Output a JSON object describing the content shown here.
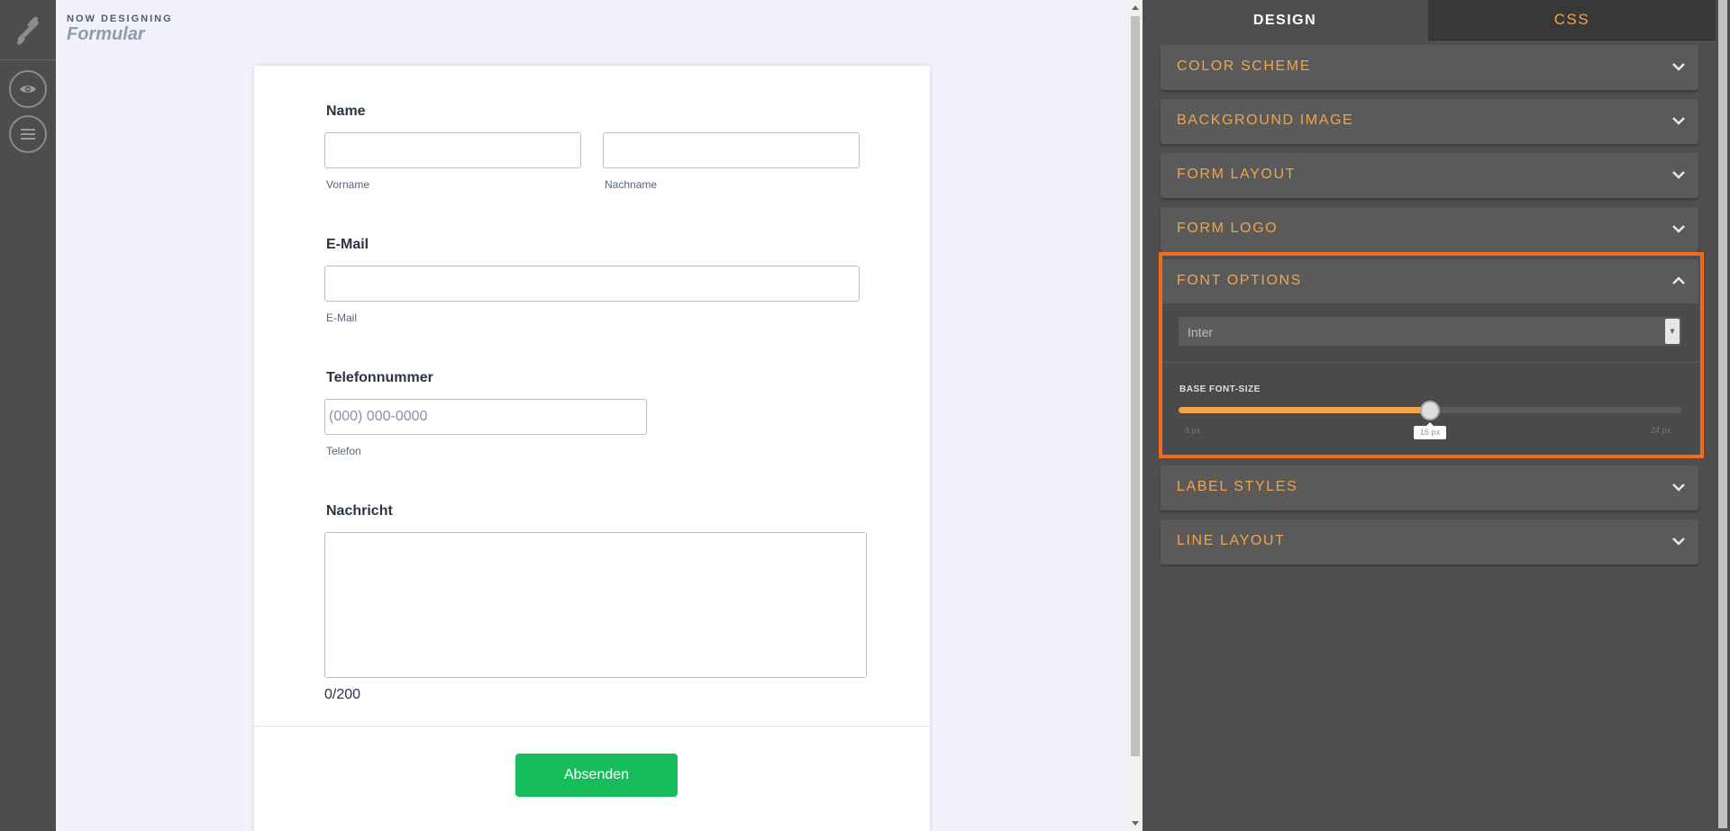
{
  "header": {
    "eyebrow": "NOW DESIGNING",
    "form_name": "Formular"
  },
  "toolbar": {
    "items": [
      {
        "icon": "eye-icon",
        "name": "preview"
      },
      {
        "icon": "hamburger-menu-icon",
        "name": "menu"
      }
    ]
  },
  "form": {
    "name_field": {
      "title": "Name",
      "first_sublabel": "Vorname",
      "last_sublabel": "Nachname",
      "first_value": "",
      "last_value": ""
    },
    "email_field": {
      "title": "E-Mail",
      "sublabel": "E-Mail",
      "value": ""
    },
    "phone_field": {
      "title": "Telefonnummer",
      "placeholder": "(000) 000-0000",
      "sublabel": "Telefon",
      "value": ""
    },
    "message_field": {
      "title": "Nachricht",
      "counter": "0/200",
      "value": ""
    },
    "submit_label": "Absenden",
    "submit_color": "#18bd5b"
  },
  "panel": {
    "tabs": [
      {
        "label": "DESIGN",
        "active": true
      },
      {
        "label": "CSS",
        "active": false
      }
    ],
    "sections": [
      {
        "label": "COLOR SCHEME",
        "expanded": false
      },
      {
        "label": "BACKGROUND IMAGE",
        "expanded": false
      },
      {
        "label": "FORM LAYOUT",
        "expanded": false
      },
      {
        "label": "FORM LOGO",
        "expanded": false
      },
      {
        "label": "FONT OPTIONS",
        "expanded": true
      },
      {
        "label": "LABEL STYLES",
        "expanded": false
      },
      {
        "label": "LINE LAYOUT",
        "expanded": false
      }
    ],
    "font_options": {
      "font_family_value": "Inter",
      "size_label": "BASE FONT-SIZE",
      "size_min": "8 px",
      "size_max": "24 px",
      "size_value_label": "16 px",
      "size_fraction": 0.5
    },
    "accent_color": "#f0a44c",
    "highlight_color": "#f26a1b"
  }
}
